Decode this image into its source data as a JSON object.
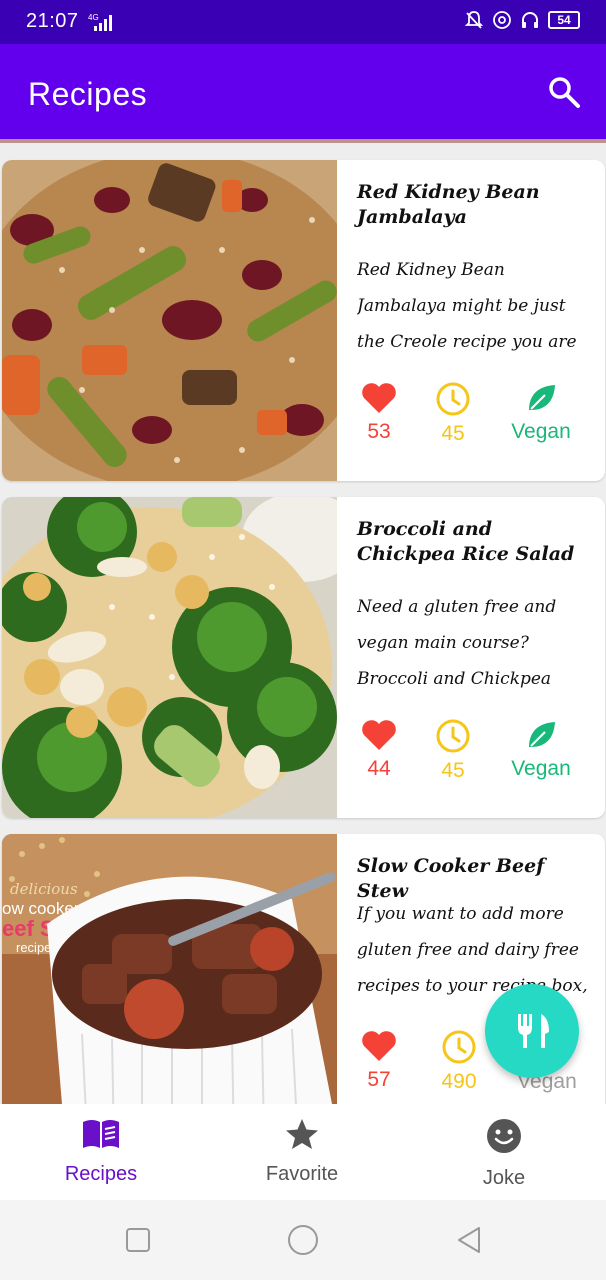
{
  "status_bar": {
    "time": "21:07",
    "network": "4G",
    "battery": "54"
  },
  "app_bar": {
    "title": "Recipes",
    "search_icon": "search-icon"
  },
  "recipes": [
    {
      "title": "Red Kidney Bean Jambalaya",
      "description": "Red Kidney Bean Jambalaya might be just the Creole recipe you are searching for. One serv...",
      "likes": "53",
      "minutes": "45",
      "diet": "Vegan"
    },
    {
      "title": "Broccoli and Chickpea Rice Salad",
      "description": "Need a gluten free and vegan main course?Broccoli and Chickpea Rice Salad could be a...",
      "likes": "44",
      "minutes": "45",
      "diet": "Vegan"
    },
    {
      "title": "Slow Cooker Beef Stew",
      "description": "If you want to add more gluten free and dairy free recipes to your recipe box, Slow Cooker B...",
      "likes": "57",
      "minutes": "490",
      "diet": "Vegan",
      "photo_caption": [
        "delicious",
        "ow cooker",
        "eef Stew",
        "recipe"
      ]
    }
  ],
  "fab": {
    "icon": "fork-knife-icon"
  },
  "bottom_nav": {
    "items": [
      {
        "label": "Recipes",
        "icon": "book-icon",
        "active": true
      },
      {
        "label": "Favorite",
        "icon": "star-icon",
        "active": false
      },
      {
        "label": "Joke",
        "icon": "smiley-icon",
        "active": false
      }
    ]
  },
  "colors": {
    "primary": "#6200ee",
    "status_bar": "#3a00b4",
    "heart": "#f44336",
    "clock": "#f5c518",
    "vegan": "#18b87a",
    "fab": "#26d9c4",
    "inactive": "#555555"
  }
}
